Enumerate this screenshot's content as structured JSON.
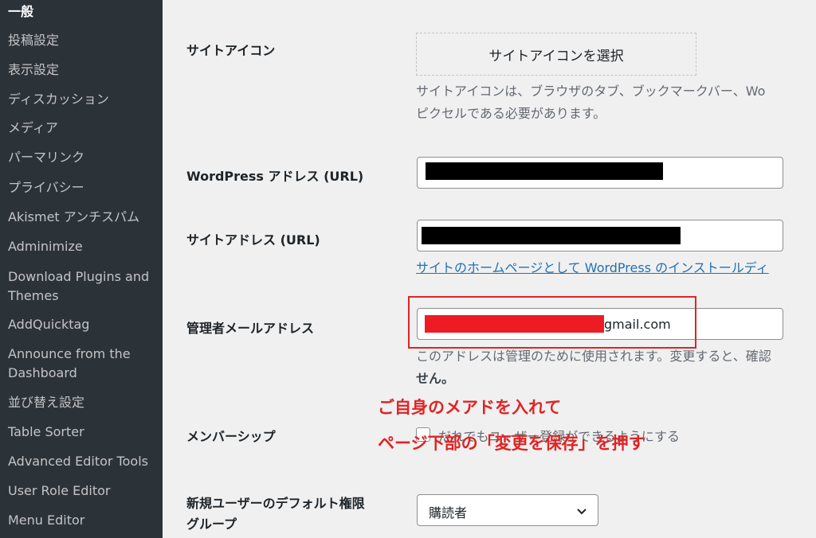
{
  "sidebar": {
    "items": [
      {
        "label": "一般"
      },
      {
        "label": "投稿設定"
      },
      {
        "label": "表示設定"
      },
      {
        "label": "ディスカッション"
      },
      {
        "label": "メディア"
      },
      {
        "label": "パーマリンク"
      },
      {
        "label": "プライバシー"
      },
      {
        "label": "Akismet アンチスパム"
      },
      {
        "label": "Adminimize"
      },
      {
        "label": "Download Plugins and"
      },
      {
        "label": "Themes"
      },
      {
        "label": "AddQuicktag"
      },
      {
        "label": "Announce from the"
      },
      {
        "label": "Dashboard"
      },
      {
        "label": "並び替え設定"
      },
      {
        "label": "Table Sorter"
      },
      {
        "label": "Advanced Editor Tools"
      },
      {
        "label": "User Role Editor"
      },
      {
        "label": "Menu Editor"
      }
    ]
  },
  "site_icon": {
    "label": "サイトアイコン",
    "button": "サイトアイコンを選択",
    "desc_line1": "サイトアイコンは、ブラウザのタブ、ブックマークバー、Wo",
    "desc_line2": "ピクセルである必要があります。"
  },
  "wp_address": {
    "label": "WordPress アドレス (URL)"
  },
  "site_address": {
    "label": "サイトアドレス (URL)",
    "link": "サイトのホームページとして WordPress のインストールディ"
  },
  "admin_email": {
    "label": "管理者メールアドレス",
    "value_visible": "gmail.com",
    "desc_line1": "このアドレスは管理のために使用されます。変更すると、確認",
    "desc_line2": "せん。"
  },
  "annotation": {
    "line1": "ご自身のメアドを入れて",
    "line2": "ページ下部の「変更を保存」を押す",
    "color": "#e02424"
  },
  "membership": {
    "label": "メンバーシップ",
    "checkbox_label": "だれでもユーザー登録ができるようにする"
  },
  "default_role": {
    "label_line1": "新規ユーザーのデフォルト権限",
    "label_line2": "グループ",
    "selected": "購読者"
  },
  "colors": {
    "sidebar_bg": "#2c3338",
    "link": "#2271b1",
    "annotation": "#e02424"
  }
}
